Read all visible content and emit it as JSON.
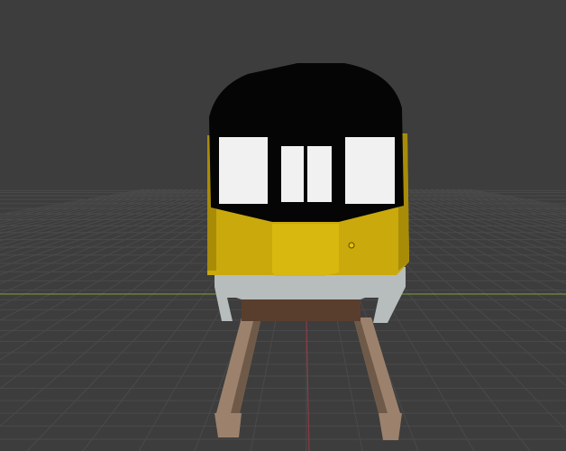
{
  "viewport": {
    "background": "#3d3d3d",
    "grid_line_color": "#4a4a4a",
    "x_axis_color": "#7f9f3a",
    "y_axis_color": "#9a3a46"
  },
  "scene": {
    "object": "train-front",
    "colors": {
      "roof": "#050505",
      "body_yellow": "#c9a90c",
      "body_yellow_dark": "#a88c08",
      "center_panel": "#d8b80e",
      "skirt_gray": "#b7bcbc",
      "skirt_gray_dark": "#8f9595",
      "window_white": "#f1f1f1",
      "bogie_brown": "#5a3e2d",
      "rail_tan": "#9c826c",
      "rail_dark": "#6f5a49"
    }
  }
}
